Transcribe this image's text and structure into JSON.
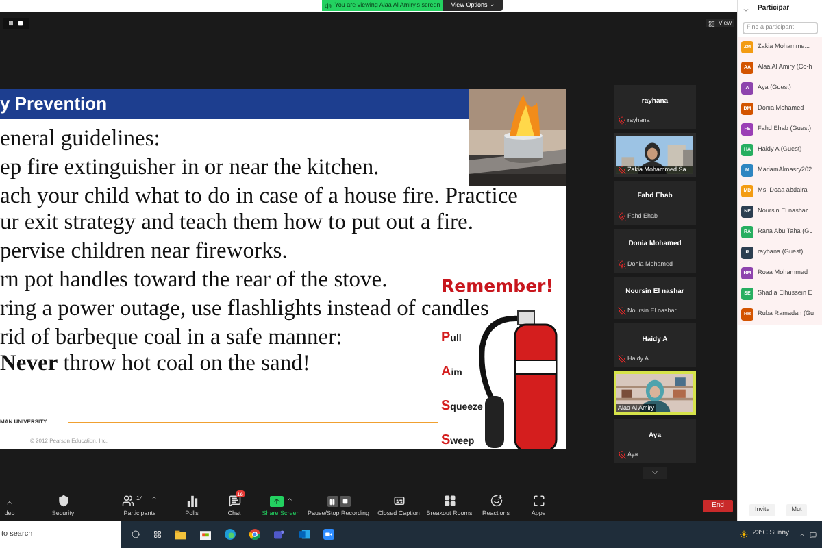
{
  "banner": {
    "text": "You are viewing Alaa Al Amiry's screen",
    "button": "View Options"
  },
  "view_button": "View",
  "slide": {
    "title": "y Prevention",
    "lines": [
      "eneral guidelines:",
      "ep fire extinguisher in or near the kitchen.",
      "ach your child what to do in case of a house fire. Practice",
      "ur exit strategy and teach them how to put out a fire.",
      "pervise children near fireworks.",
      "rn pot handles toward the rear of the stove.",
      "ring a power outage, use flashlights instead of candles",
      " rid of barbeque coal in a safe manner:",
      "**Never** throw hot coal on the sand!"
    ],
    "remember": "Remember!",
    "steps": [
      {
        "initial": "P",
        "rest": "ull"
      },
      {
        "initial": "A",
        "rest": "im"
      },
      {
        "initial": "S",
        "rest": "queeze"
      },
      {
        "initial": "S",
        "rest": "weep"
      }
    ],
    "logo_text": "MAN UNIVERSITY",
    "copyright": "© 2012 Pearson Education, Inc."
  },
  "gallery": [
    {
      "kind": "name",
      "title": "rayhana",
      "label": "rayhana",
      "muted": true,
      "speaking": false
    },
    {
      "kind": "video",
      "label": "Zakia Mohammed Sa...",
      "muted": true,
      "speaking": false
    },
    {
      "kind": "name",
      "title": "Fahd Ehab",
      "label": "Fahd Ehab",
      "muted": true,
      "speaking": false
    },
    {
      "kind": "name",
      "title": "Donia Mohamed",
      "label": "Donia Mohamed",
      "muted": true,
      "speaking": false
    },
    {
      "kind": "name",
      "title": "Noursin El nashar",
      "label": "Noursin El nashar",
      "muted": true,
      "speaking": false
    },
    {
      "kind": "name",
      "title": "Haidy A",
      "label": "Haidy A",
      "muted": true,
      "speaking": false
    },
    {
      "kind": "video",
      "label": "Alaa Al Amiry",
      "muted": false,
      "speaking": true
    },
    {
      "kind": "name",
      "title": "Aya",
      "label": "Aya",
      "muted": true,
      "speaking": false
    }
  ],
  "participants": {
    "title": "Participar",
    "search": {
      "placeholder": "Find a participant"
    },
    "items": [
      {
        "initials": "ZM",
        "color": "#f39c12",
        "name": "Zakia Mohamme..."
      },
      {
        "initials": "AA",
        "color": "#d35400",
        "name": "Alaa Al Amiry (Co-h"
      },
      {
        "initials": "A",
        "color": "#8e44ad",
        "name": "Aya (Guest)"
      },
      {
        "initials": "DM",
        "color": "#d35400",
        "name": "Donia Mohamed"
      },
      {
        "initials": "FE",
        "color": "#9b3fb5",
        "name": "Fahd Ehab (Guest)"
      },
      {
        "initials": "HA",
        "color": "#27ae60",
        "name": "Haidy A (Guest)"
      },
      {
        "initials": "M",
        "color": "#2e86c1",
        "name": "MariamAlmasry202"
      },
      {
        "initials": "MD",
        "color": "#f39c12",
        "name": "Ms. Doaa abdalra"
      },
      {
        "initials": "NE",
        "color": "#2c3e50",
        "name": "Noursin El nashar"
      },
      {
        "initials": "RA",
        "color": "#27ae60",
        "name": "Rana Abu Taha (Gu"
      },
      {
        "initials": "R",
        "color": "#2c3e50",
        "name": "rayhana (Guest)"
      },
      {
        "initials": "RM",
        "color": "#8e44ad",
        "name": "Roaa Mohammed"
      },
      {
        "initials": "SE",
        "color": "#27ae60",
        "name": "Shadia Elhussein E"
      },
      {
        "initials": "RR",
        "color": "#d35400",
        "name": "Ruba Ramadan (Gu"
      }
    ],
    "buttons": [
      "Invite",
      "Mut"
    ]
  },
  "toolbar": [
    {
      "kind": "video",
      "label": "deo"
    },
    {
      "kind": "security",
      "label": "Security"
    },
    {
      "kind": "participants",
      "label": "Participants",
      "count": "14"
    },
    {
      "kind": "polls",
      "label": "Polls"
    },
    {
      "kind": "chat",
      "label": "Chat",
      "badge": "16"
    },
    {
      "kind": "share",
      "label": "Share Screen"
    },
    {
      "kind": "record",
      "label": "Pause/Stop Recording"
    },
    {
      "kind": "captions",
      "label": "Closed Caption"
    },
    {
      "kind": "breakout",
      "label": "Breakout Rooms"
    },
    {
      "kind": "reactions",
      "label": "Reactions"
    },
    {
      "kind": "apps",
      "label": "Apps"
    }
  ],
  "end_button": "End",
  "taskbar": {
    "search": "to search",
    "weather": "23°C Sunny"
  }
}
